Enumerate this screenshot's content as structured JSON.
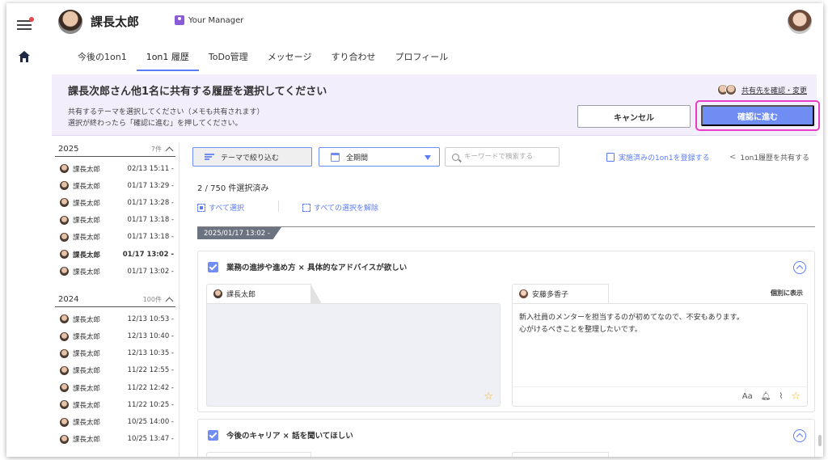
{
  "header": {
    "user_name": "課長太郎",
    "manager_label": "Your Manager"
  },
  "tabs": [
    {
      "label": "今後の1on1"
    },
    {
      "label": "1on1 履歴",
      "active": true
    },
    {
      "label": "ToDo管理"
    },
    {
      "label": "メッセージ"
    },
    {
      "label": "すり合わせ"
    },
    {
      "label": "プロフィール"
    }
  ],
  "banner": {
    "title": "課長次郎さん他1名に共有する履歴を選択してください",
    "desc_line1": "共有するテーマを選択してください（メモも共有されます）",
    "desc_line2": "選択が終わったら「確認に進む」を押してください。",
    "share_link": "共有先を確認・変更",
    "cancel_label": "キャンセル",
    "confirm_label": "確認に進む",
    "highlight_color": "#e83dc4",
    "accent_color": "#6f8df2"
  },
  "sidebar": {
    "years": [
      {
        "year": "2025",
        "count": "7件",
        "items": [
          {
            "name": "課長太郎",
            "date": "02/13 15:11 -"
          },
          {
            "name": "課長太郎",
            "date": "01/17 13:29 -"
          },
          {
            "name": "課長太郎",
            "date": "01/17 13:28 -"
          },
          {
            "name": "課長太郎",
            "date": "01/17 13:18 -"
          },
          {
            "name": "課長太郎",
            "date": "01/17 13:18 -"
          },
          {
            "name": "課長太郎",
            "date": "01/17 13:02 -",
            "selected": true
          },
          {
            "name": "課長太郎",
            "date": "01/17 13:02 -"
          }
        ]
      },
      {
        "year": "2024",
        "count": "100件",
        "items": [
          {
            "name": "課長太郎",
            "date": "12/13 10:53 -"
          },
          {
            "name": "課長太郎",
            "date": "12/13 10:40 -"
          },
          {
            "name": "課長太郎",
            "date": "12/13 10:35 -"
          },
          {
            "name": "課長太郎",
            "date": "11/22 12:55 -"
          },
          {
            "name": "課長太郎",
            "date": "11/22 12:42 -"
          },
          {
            "name": "課長太郎",
            "date": "11/22 10:25 -"
          },
          {
            "name": "課長太郎",
            "date": "10/25 14:00 -"
          },
          {
            "name": "課長太郎",
            "date": "10/25 13:47 -"
          }
        ]
      }
    ]
  },
  "toolbar": {
    "filter_label": "テーマで絞り込む",
    "period_label": "全期間",
    "search_placeholder": "キーワードで検索する",
    "register_label": "実施済みの1on1を登録する",
    "share_history_label": "1on1履歴を共有する"
  },
  "selection": {
    "count_text": "2 / 750 件選択済み",
    "select_all": "すべて選択",
    "deselect_all": "すべての選択を解除"
  },
  "session_date": "2025/01/17 13:02 -",
  "cards": [
    {
      "title": "業務の進捗や進め方 × 具体的なアドバイスが欲しい",
      "left_author": "課長太郎",
      "right_author": "安藤多香子",
      "right_toggle": "個別に表示",
      "right_line1": "新入社員のメンターを担当するのが初めてなので、不安もあります。",
      "right_line2": "心がけるべきことを整理したいです。",
      "font_tool": "Aa"
    },
    {
      "title": "今後のキャリア × 話を聞いてほしい"
    }
  ]
}
